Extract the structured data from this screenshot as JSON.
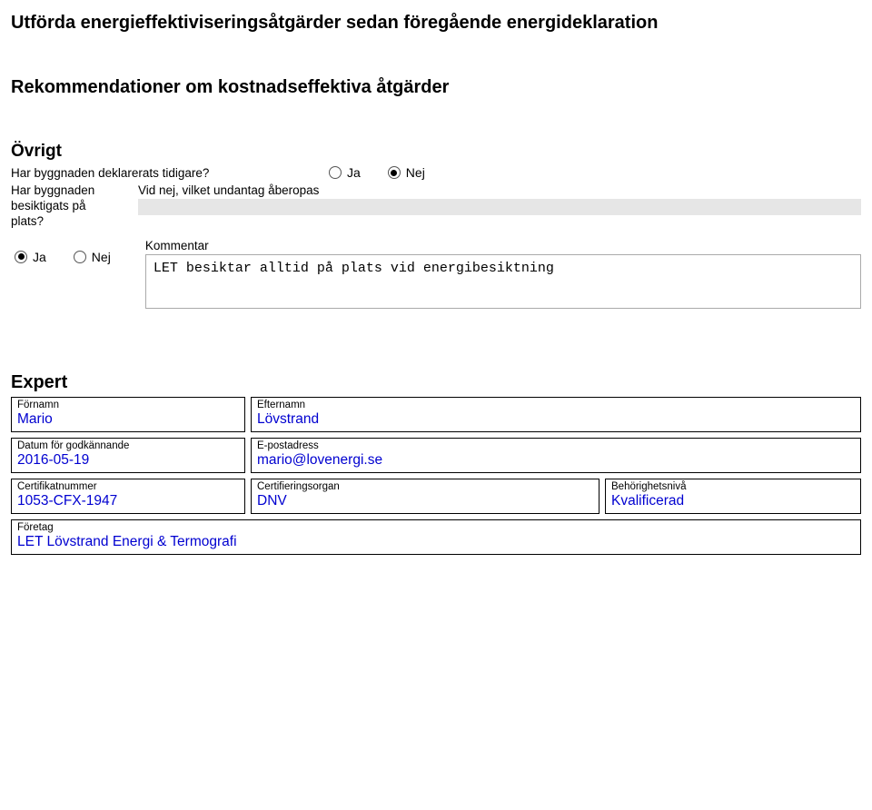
{
  "sections": {
    "utforda": "Utförda energieffektiviseringsåtgärder sedan föregående energideklaration",
    "rekommendationer": "Rekommendationer om kostnadseffektiva åtgärder",
    "ovrigt": "Övrigt"
  },
  "q_declared": {
    "label": "Har byggnaden deklarerats tidigare?",
    "ja": "Ja",
    "nej": "Nej",
    "selected": "nej"
  },
  "q_inspected": {
    "label1": "Har byggnaden",
    "label2": "besiktigats på plats?",
    "undantag_label": "Vid nej, vilket undantag åberopas",
    "undantag_value": "",
    "ja": "Ja",
    "nej": "Nej",
    "selected": "ja"
  },
  "kommentar": {
    "label": "Kommentar",
    "text": "LET besiktar alltid på plats vid energibesiktning"
  },
  "expert": {
    "title": "Expert",
    "fornamn_label": "Förnamn",
    "fornamn": "Mario",
    "efternamn_label": "Efternamn",
    "efternamn": "Lövstrand",
    "datum_label": "Datum för godkännande",
    "datum": "2016-05-19",
    "epost_label": "E-postadress",
    "epost": "mario@lovenergi.se",
    "cert_label": "Certifikatnummer",
    "cert": "1053-CFX-1947",
    "organ_label": "Certifieringsorgan",
    "organ": "DNV",
    "niva_label": "Behörighetsnivå",
    "niva": "Kvalificerad",
    "foretag_label": "Företag",
    "foretag": "LET Lövstrand Energi & Termografi"
  }
}
